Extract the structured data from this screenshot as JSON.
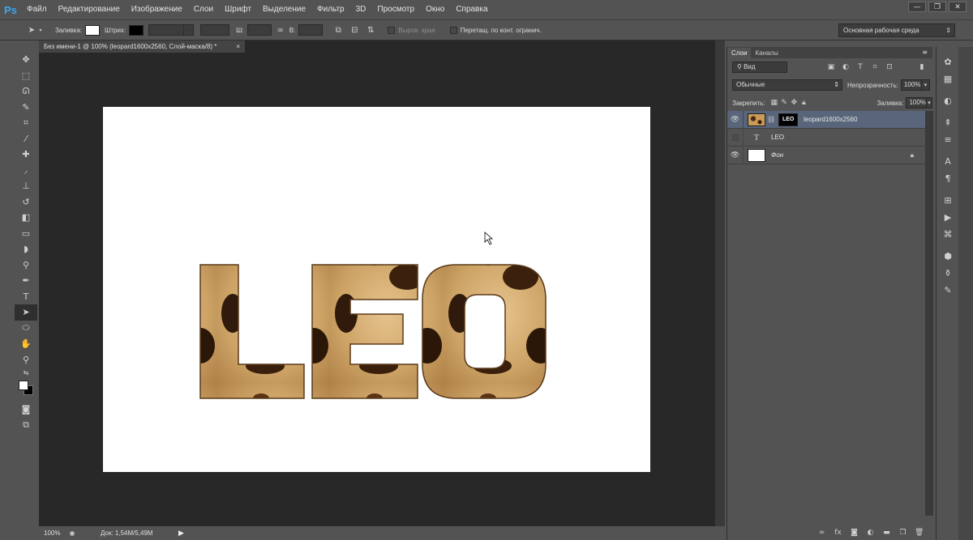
{
  "app": {
    "logo": "Ps"
  },
  "menu": [
    "Файл",
    "Редактирование",
    "Изображение",
    "Слои",
    "Шрифт",
    "Выделение",
    "Фильтр",
    "3D",
    "Просмотр",
    "Окно",
    "Справка"
  ],
  "window_controls": {
    "minimize": "—",
    "restore": "❐",
    "close": "✕"
  },
  "options_bar": {
    "fill_label": "Заливка:",
    "stroke_label": "Штрих:",
    "width_label": "Ш:",
    "height_label": "В:",
    "align_edges_label": "Выров. края",
    "constrain_label": "Перетащ. по конт. огранич.",
    "workspace": "Основная рабочая среда",
    "fill_color": "#ffffff",
    "stroke_color": "#000000"
  },
  "document": {
    "tab_title": "Без имени-1 @ 100% (leopard1600x2560, Слой-маска/8) *",
    "tab_close": "×",
    "canvas_text": "LEO",
    "canvas_bg": "#ffffff"
  },
  "status_bar": {
    "zoom": "100%",
    "doc_size": "Док: 1,54M/5,49M",
    "arrow": "▶"
  },
  "layers_panel": {
    "tabs": [
      "Слои",
      "Каналы"
    ],
    "kind_filter": "Вид",
    "blend_mode": "Обычные",
    "opacity_label": "Непрозрачность:",
    "opacity": "100%",
    "lock_label": "Закрепить:",
    "fill_label": "Заливка:",
    "fill": "100%",
    "layers": [
      {
        "name": "leopard1600x2560",
        "mask_text": "LEO",
        "visible": true,
        "selected": true
      },
      {
        "name": "LEO",
        "type": "text",
        "visible": false,
        "selected": false
      },
      {
        "name": "Фон",
        "locked": true,
        "visible": true,
        "selected": false
      }
    ]
  },
  "colors": {
    "foreground": "#ffffff",
    "background": "#000000",
    "selected_layer": "#59657a",
    "accent": "#3aa8f0"
  }
}
